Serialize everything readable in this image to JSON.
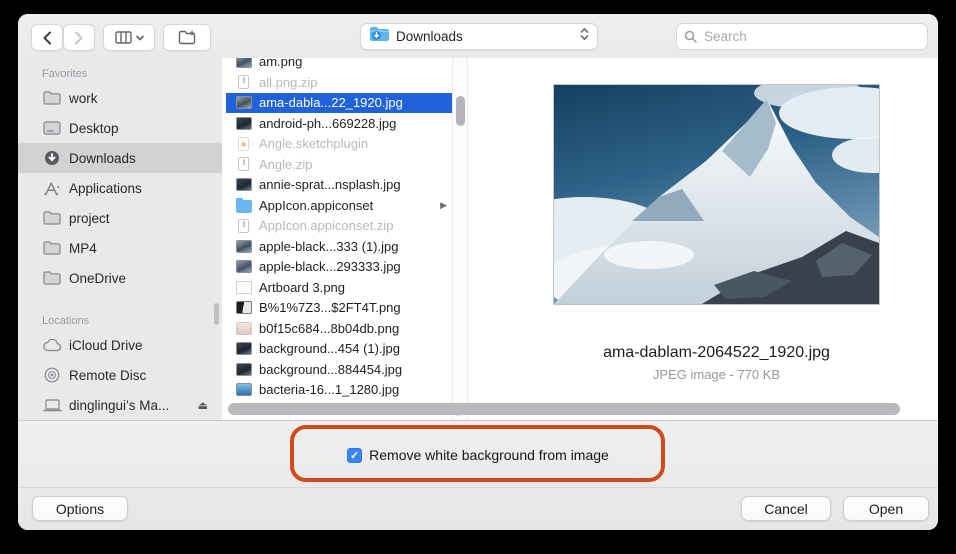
{
  "toolbar": {
    "location": {
      "label": "Downloads"
    },
    "search": {
      "placeholder": "Search"
    }
  },
  "sidebar": {
    "sections": [
      {
        "title": "Favorites",
        "items": [
          {
            "label": "work"
          },
          {
            "label": "Desktop"
          },
          {
            "label": "Downloads",
            "selected": true
          },
          {
            "label": "Applications"
          },
          {
            "label": "project"
          },
          {
            "label": "MP4"
          },
          {
            "label": "OneDrive"
          }
        ]
      },
      {
        "title": "Locations",
        "items": [
          {
            "label": "iCloud Drive"
          },
          {
            "label": "Remote Disc"
          },
          {
            "label": "dinglingui’s Ma...",
            "eject_glyph": "⏏"
          }
        ]
      }
    ]
  },
  "files": {
    "items": [
      {
        "name": "am.png"
      },
      {
        "name": "all.png.zip",
        "disabled": true
      },
      {
        "name": "ama-dabla...22_1920.jpg",
        "selected": true
      },
      {
        "name": "android-ph...669228.jpg"
      },
      {
        "name": "Angle.sketchplugin",
        "disabled": true
      },
      {
        "name": "Angle.zip",
        "disabled": true
      },
      {
        "name": "annie-sprat...nsplash.jpg"
      },
      {
        "name": "AppIcon.appiconset",
        "disclosure_glyph": "▶"
      },
      {
        "name": "AppIcon.appiconset.zip",
        "disabled": true
      },
      {
        "name": "apple-black...333 (1).jpg"
      },
      {
        "name": "apple-black...293333.jpg"
      },
      {
        "name": "Artboard 3.png"
      },
      {
        "name": "B%1%7Z3...$2FT4T.png"
      },
      {
        "name": "b0f15c684...8b04db.png"
      },
      {
        "name": "background...454 (1).jpg"
      },
      {
        "name": "background...884454.jpg"
      },
      {
        "name": "bacteria-16...1_1280.jpg"
      }
    ]
  },
  "preview": {
    "filename": "ama-dablam-2064522_1920.jpg",
    "meta": "JPEG image - 770 KB"
  },
  "footer": {
    "checkbox": {
      "label": "Remove white background from image",
      "checked": true,
      "check_glyph": "✓"
    },
    "options_label": "Options",
    "cancel_label": "Cancel",
    "open_label": "Open"
  },
  "colors": {
    "selection_blue": "#1f62d9",
    "checkbox_blue": "#3a82f6",
    "annotation_orange": "#cf4a1d",
    "folder_blue": "#5fb3ef"
  }
}
